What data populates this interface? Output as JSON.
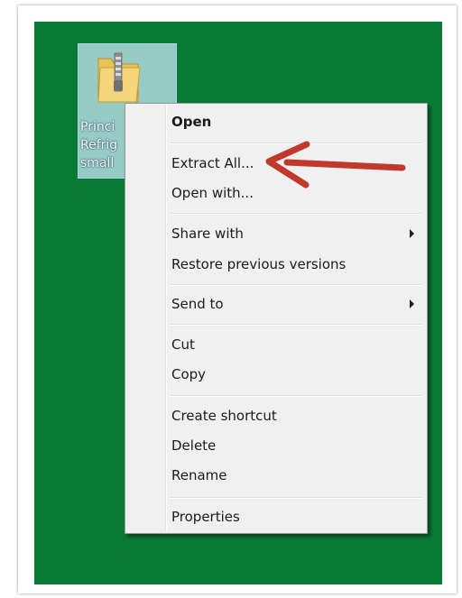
{
  "desktop": {
    "background_color": "#0a7a35",
    "file": {
      "icon": "zip-folder-icon",
      "label_lines": [
        "Princi",
        "Refrig",
        "small"
      ]
    }
  },
  "context_menu": {
    "items": [
      {
        "label": "Open",
        "bold": true
      },
      {
        "label": "Extract All..."
      },
      {
        "label": "Open with..."
      },
      {
        "label": "Share with",
        "submenu": true
      },
      {
        "label": "Restore previous versions"
      },
      {
        "label": "Send to",
        "submenu": true
      },
      {
        "label": "Cut"
      },
      {
        "label": "Copy"
      },
      {
        "label": "Create shortcut"
      },
      {
        "label": "Delete"
      },
      {
        "label": "Rename"
      },
      {
        "label": "Properties"
      }
    ]
  },
  "annotation": {
    "icon": "red-arrow-icon",
    "color": "#c0392b",
    "points_to": "Extract All..."
  }
}
